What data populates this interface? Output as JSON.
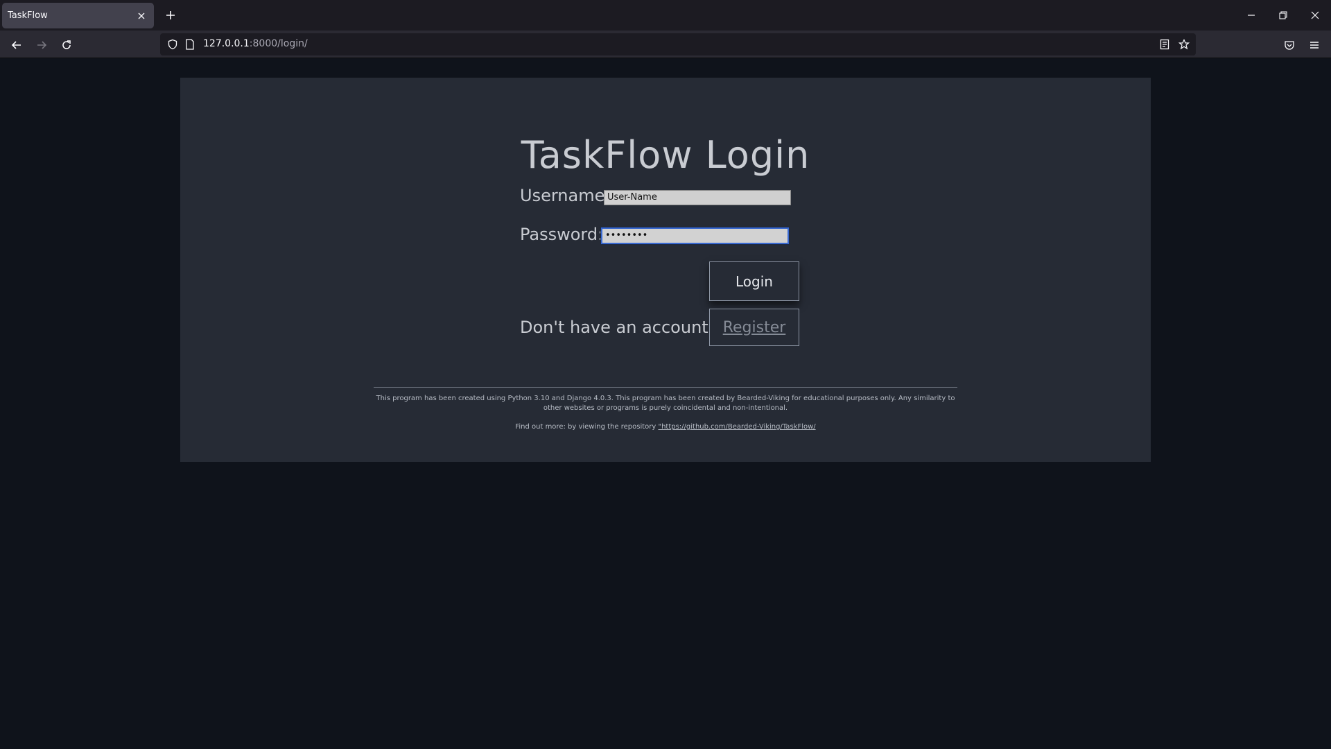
{
  "browser": {
    "tab_title": "TaskFlow",
    "url_host": "127.0.0.1",
    "url_path": ":8000/login/"
  },
  "login": {
    "title": "TaskFlow Login",
    "username_label": "Username:",
    "username_value": "User-Name",
    "password_label": "Password:",
    "password_value": "••••••••",
    "login_button": "Login",
    "no_account_text": "Don't have an account?",
    "register_button": "Register"
  },
  "footer": {
    "disclaimer": "This program has been created using Python 3.10 and Django 4.0.3. This program has been created by Bearded-Viking for educational purposes only. Any similarity to other websites or programs is purely coincidental and non-intentional.",
    "repo_prefix": "Find out more: by viewing the repository ",
    "repo_link": "\"https://github.com/Bearded-Viking/TaskFlow/"
  },
  "colors": {
    "page_bg": "#0f131b",
    "card_bg": "#262b35",
    "focus_ring": "#3a6ad1"
  }
}
